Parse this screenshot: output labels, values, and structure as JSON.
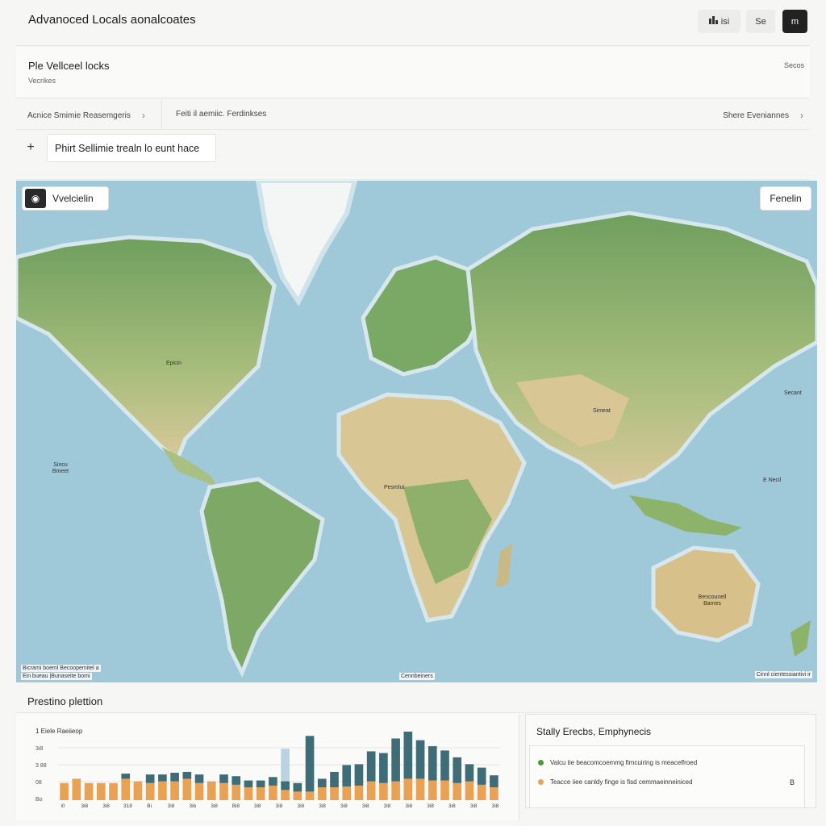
{
  "header": {
    "app_title": "Advanoced Locals aonalcoates",
    "buttons": [
      {
        "label": "isi",
        "icon": "chart-icon"
      },
      {
        "label": "Se"
      },
      {
        "label": "m",
        "icon": "menu-icon"
      }
    ]
  },
  "section": {
    "title": "Ple Vellceel locks",
    "subtitle": "Vecrikes",
    "right_label": "Secos"
  },
  "breadcrumbs": {
    "items": [
      "Acnice Smimie Reasemgeris",
      "Feiti il aemiic. Ferdinkses"
    ],
    "right": "Shere Eveniannes"
  },
  "action": {
    "plus": "+",
    "label": "Phirt Sellimie trealn lo eunt hace"
  },
  "map": {
    "chip_left": "Vvelcielin",
    "chip_right": "Fenelin",
    "labels": [
      "Epicin",
      "Sincu Bmeet",
      "Simeat",
      "Pesmlut",
      "Secant",
      "E Necil",
      "Bencounell Bames"
    ],
    "attribution_left": [
      "Bicrami boeml Becoopemitel a",
      "Ein bueau |Bunaseite bomi"
    ],
    "attribution_center": "Cennbeiners",
    "attribution_right": "Cinnl cientessiantivi ir"
  },
  "bottom": {
    "title": "Prestino plettion"
  },
  "chart_data": {
    "type": "bar",
    "ylabel": "1 Eiele Raeiieop",
    "y_ticks": [
      "3i8",
      "3 88",
      "08",
      "Bo"
    ],
    "x_ticks": [
      "i0",
      "3i8",
      "3i8",
      "318",
      "Bi",
      "3i8",
      "3ib",
      "3i8",
      "Bi8",
      "3i8",
      "3i8",
      "3i8",
      "3i8",
      "3i8",
      "3i8",
      "3i8",
      "3i8",
      "3i8",
      "3i8",
      "3i8",
      "3i8"
    ],
    "ylim": [
      0,
      80
    ],
    "series": [
      {
        "name": "orange",
        "color": "#e9a254",
        "values": [
          20,
          25,
          20,
          20,
          20,
          25,
          22,
          20,
          22,
          22,
          25,
          20,
          22,
          20,
          18,
          15,
          15,
          17,
          12,
          10,
          10,
          15,
          15,
          16,
          17,
          22,
          20,
          22,
          25,
          25,
          23,
          23,
          20,
          22,
          18,
          15
        ]
      },
      {
        "name": "teal",
        "color": "#3e6d78",
        "values": [
          0,
          0,
          0,
          0,
          0,
          6,
          0,
          10,
          8,
          10,
          8,
          10,
          0,
          10,
          10,
          8,
          8,
          10,
          10,
          10,
          65,
          10,
          18,
          25,
          25,
          35,
          35,
          50,
          55,
          45,
          40,
          35,
          30,
          20,
          20,
          14
        ]
      },
      {
        "name": "highlight",
        "color": "#b9d4e0",
        "values": [
          0,
          0,
          0,
          0,
          0,
          0,
          0,
          0,
          0,
          18,
          0,
          0,
          0,
          0,
          0,
          0,
          0,
          0,
          60,
          0,
          0,
          0,
          0,
          0,
          0,
          0,
          0,
          0,
          0,
          0,
          0,
          0,
          0,
          0,
          0,
          0
        ]
      }
    ]
  },
  "summary": {
    "title": "Stally Erecbs, Emphynecis",
    "rows": [
      {
        "color": "#4c9a3f",
        "label": "Valcu tie beacomcoemmg fimcuiring is meacelfroed"
      },
      {
        "color": "#e9a254",
        "label": "Teacce iiee canldy finge is fisd cemmaeinneiniced"
      }
    ],
    "value": "B"
  }
}
